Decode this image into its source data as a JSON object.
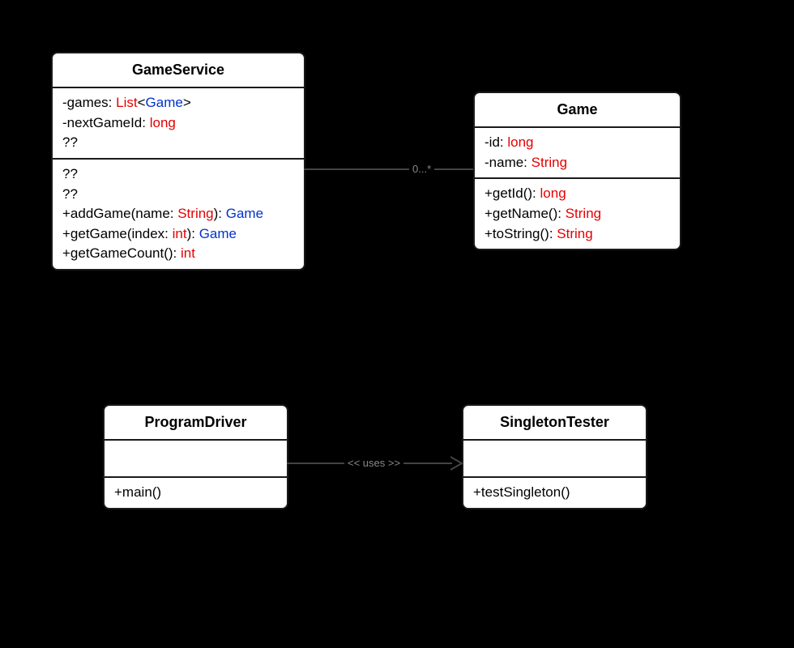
{
  "classes": {
    "gameService": {
      "title": "GameService",
      "attr1_pre": "-games: ",
      "attr1_type1": "List",
      "attr1_lt": "<",
      "attr1_type2": "Game",
      "attr1_gt": ">",
      "attr2_pre": "-nextGameId: ",
      "attr2_type": "long",
      "attr3": "??",
      "op1": "??",
      "op2": "??",
      "op3_pre": "+addGame(name: ",
      "op3_arg": "String",
      "op3_mid": "): ",
      "op3_ret": "Game",
      "op4_pre": "+getGame(index: ",
      "op4_arg": "int",
      "op4_mid": "): ",
      "op4_ret": "Game",
      "op5_pre": "+getGameCount(): ",
      "op5_ret": "int"
    },
    "game": {
      "title": "Game",
      "attr1_pre": "-id: ",
      "attr1_type": "long",
      "attr2_pre": "-name: ",
      "attr2_type": "String",
      "op1_pre": "+getId(): ",
      "op1_ret": "long",
      "op2_pre": "+getName(): ",
      "op2_ret": "String",
      "op3_pre": "+toString(): ",
      "op3_ret": "String"
    },
    "programDriver": {
      "title": "ProgramDriver",
      "op1": "+main()"
    },
    "singletonTester": {
      "title": "SingletonTester",
      "op1": "+testSingleton()"
    }
  },
  "relations": {
    "assoc_multiplicity": "0...*",
    "uses_label": "<< uses >>"
  }
}
